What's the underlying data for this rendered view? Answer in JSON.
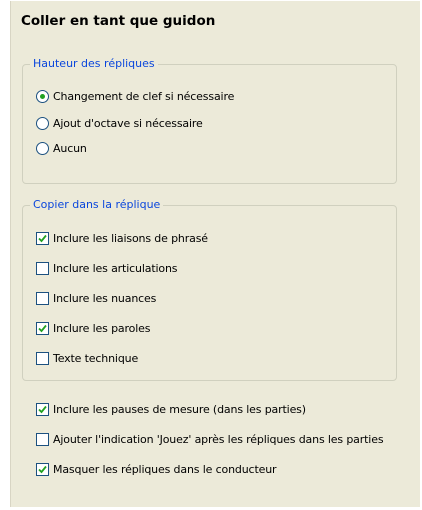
{
  "dialog": {
    "title": "Coller en tant que guidon"
  },
  "pitch_group": {
    "legend": "Hauteur des répliques",
    "options": [
      {
        "label": "Changement de clef si nécessaire",
        "mnemonic": "C",
        "selected": true
      },
      {
        "label": "Ajout d'octave si nécessaire",
        "mnemonic": "",
        "selected": false
      },
      {
        "label": "Aucun",
        "mnemonic": "",
        "selected": false
      }
    ]
  },
  "copy_group": {
    "legend": "Copier dans la réplique",
    "items": [
      {
        "label": "Inclure les liaisons de phrasé",
        "checked": true
      },
      {
        "label": "Inclure les articulations",
        "checked": false
      },
      {
        "label": "Inclure les nuances",
        "checked": false
      },
      {
        "label": "Inclure les paroles",
        "checked": true
      },
      {
        "label": "Texte technique",
        "checked": false
      }
    ]
  },
  "bottom_options": [
    {
      "label": "Inclure les pauses de mesure (dans les parties)",
      "checked": true
    },
    {
      "label": "Ajouter l'indication 'Jouez' après les répliques dans les parties",
      "checked": false
    },
    {
      "label": "Masquer les répliques dans le conducteur",
      "checked": true
    }
  ],
  "colors": {
    "panel_bg": "#ecead9",
    "legend_text": "#0a46dc",
    "radio_dot": "#21a121",
    "check_mark": "#21a121",
    "control_border": "#1c5180"
  }
}
